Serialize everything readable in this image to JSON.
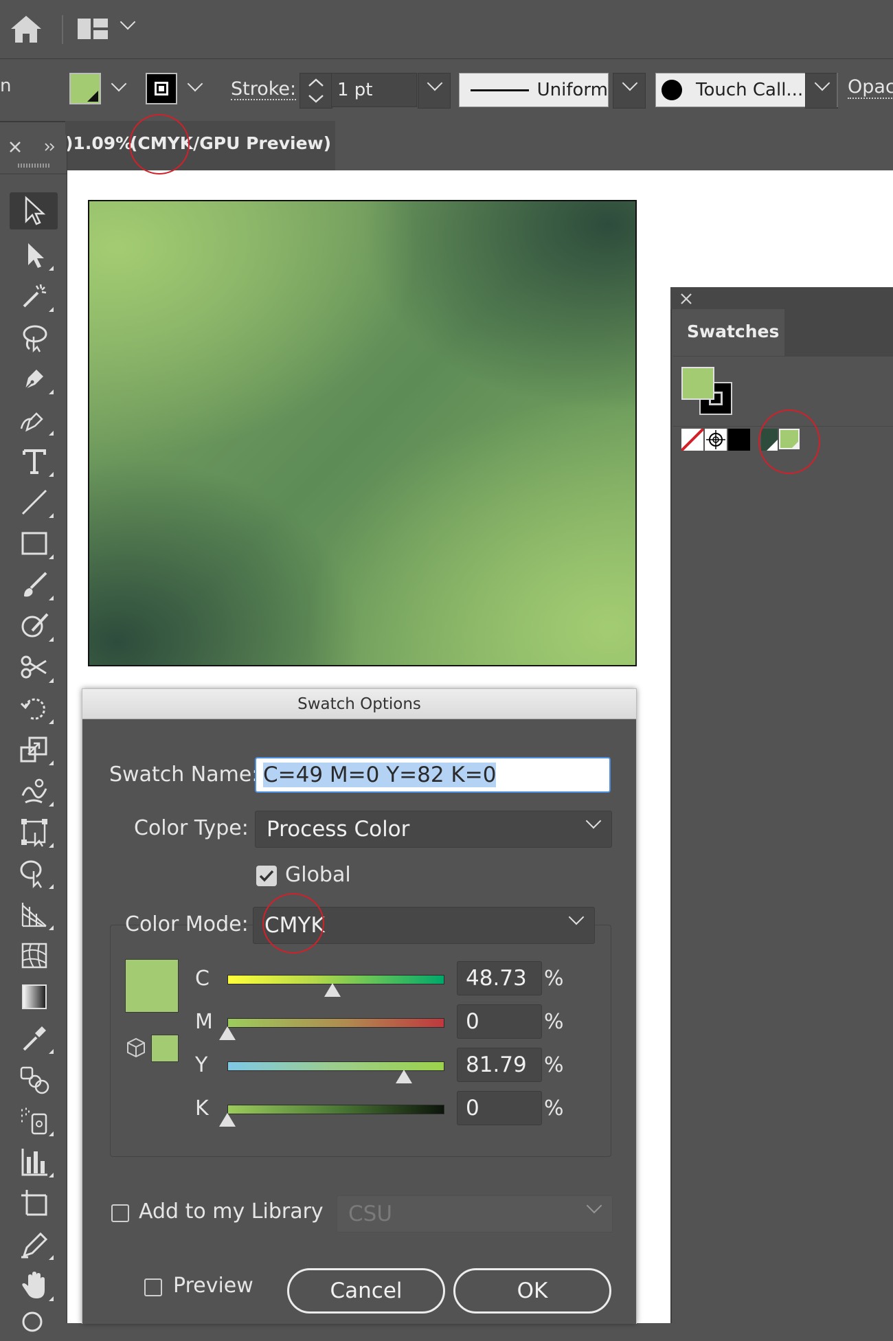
{
  "colors": {
    "fill_green": "#a3cc72",
    "highlight_red": "#d0212a",
    "panel_bg": "#535353"
  },
  "control_bar": {
    "cut_text": "n",
    "stroke_label": "Stroke:",
    "stroke_weight": "1 pt",
    "profile_label": "Uniform",
    "brush_label": "Touch Call...",
    "opacity_label": "Opaci"
  },
  "document_tab": {
    "zoom_text": ")1.09%",
    "mode_text": "(CMYK/GPU Preview)"
  },
  "swatches_panel": {
    "tab_label": "Swatches"
  },
  "dialog": {
    "title": "Swatch Options",
    "swatch_name_label": "Swatch Name:",
    "swatch_name_value": "C=49 M=0 Y=82 K=0",
    "color_type_label": "Color Type:",
    "color_type_value": "Process Color",
    "global_label": "Global",
    "global_checked": true,
    "color_mode_label": "Color Mode:",
    "color_mode_value": "CMYK",
    "channels": [
      {
        "letter": "C",
        "value": "48.73",
        "fraction": 0.4873,
        "unit": "%"
      },
      {
        "letter": "M",
        "value": "0",
        "fraction": 0.0,
        "unit": "%"
      },
      {
        "letter": "Y",
        "value": "81.79",
        "fraction": 0.8179,
        "unit": "%"
      },
      {
        "letter": "K",
        "value": "0",
        "fraction": 0.0,
        "unit": "%"
      }
    ],
    "library_label": "Add to my Library",
    "library_value": "CSU",
    "preview_label": "Preview",
    "cancel_label": "Cancel",
    "ok_label": "OK"
  }
}
